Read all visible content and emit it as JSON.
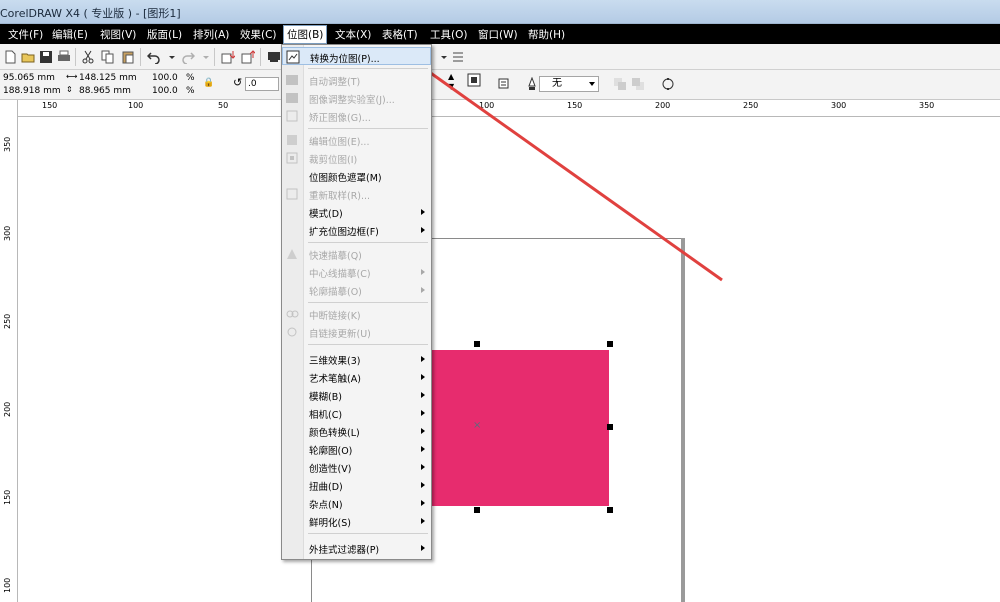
{
  "window": {
    "title": "CorelDRAW X4 ( 专业版 ) - [图形1]"
  },
  "menubar": {
    "items": [
      {
        "label": "文件(F)"
      },
      {
        "label": "编辑(E)"
      },
      {
        "label": "视图(V)"
      },
      {
        "label": "版面(L)"
      },
      {
        "label": "排列(A)"
      },
      {
        "label": "效果(C)"
      },
      {
        "label": "位图(B)"
      },
      {
        "label": "文本(X)"
      },
      {
        "label": "表格(T)"
      },
      {
        "label": "工具(O)"
      },
      {
        "label": "窗口(W)"
      },
      {
        "label": "帮助(H)"
      }
    ],
    "active": "位图(B)"
  },
  "propbar": {
    "x": "95.065 mm",
    "y": "188.918 mm",
    "width": "148.125 mm",
    "height": "88.965 mm",
    "scale_w": "100.0",
    "scale_h": "100.0",
    "percent": "%",
    "rotation": ".0",
    "outline": "无"
  },
  "rulers": {
    "h_ticks": [
      "150",
      "100",
      "50",
      "100",
      "150",
      "200",
      "250",
      "300",
      "350"
    ],
    "v_ticks": [
      "350",
      "300",
      "250",
      "200",
      "150",
      "100"
    ]
  },
  "bitmap_menu": {
    "items": [
      {
        "label": "转换为位图(P)...",
        "enabled": true,
        "icon": "convert-bitmap-icon",
        "highlighted": true
      },
      {
        "label": "自动调整(T)",
        "enabled": false,
        "icon": "auto-adjust-icon"
      },
      {
        "label": "图像调整实验室(J)...",
        "enabled": false,
        "icon": "image-lab-icon"
      },
      {
        "label": "矫正图像(G)...",
        "enabled": false,
        "icon": "straighten-icon"
      },
      {
        "label": "编辑位图(E)...",
        "enabled": false,
        "icon": "edit-bitmap-icon"
      },
      {
        "label": "裁剪位图(I)",
        "enabled": false,
        "icon": "crop-bitmap-icon"
      },
      {
        "label": "位图颜色遮罩(M)",
        "enabled": true
      },
      {
        "label": "重新取样(R)...",
        "enabled": false,
        "icon": "resample-icon"
      },
      {
        "label": "模式(D)",
        "enabled": true,
        "submenu": true
      },
      {
        "label": "扩充位图边框(F)",
        "enabled": true,
        "submenu": true
      },
      {
        "label": "快速描摹(Q)",
        "enabled": false,
        "icon": "quick-trace-icon"
      },
      {
        "label": "中心线描摹(C)",
        "enabled": false,
        "submenu": true
      },
      {
        "label": "轮廓描摹(O)",
        "enabled": false,
        "submenu": true
      },
      {
        "label": "中断链接(K)",
        "enabled": false,
        "icon": "break-link-icon"
      },
      {
        "label": "自链接更新(U)",
        "enabled": false,
        "icon": "update-link-icon"
      },
      {
        "label": "三维效果(3)",
        "enabled": true,
        "submenu": true
      },
      {
        "label": "艺术笔触(A)",
        "enabled": true,
        "submenu": true
      },
      {
        "label": "模糊(B)",
        "enabled": true,
        "submenu": true
      },
      {
        "label": "相机(C)",
        "enabled": true,
        "submenu": true
      },
      {
        "label": "颜色转换(L)",
        "enabled": true,
        "submenu": true
      },
      {
        "label": "轮廓图(O)",
        "enabled": true,
        "submenu": true
      },
      {
        "label": "创造性(V)",
        "enabled": true,
        "submenu": true
      },
      {
        "label": "扭曲(D)",
        "enabled": true,
        "submenu": true
      },
      {
        "label": "杂点(N)",
        "enabled": true,
        "submenu": true
      },
      {
        "label": "鲜明化(S)",
        "enabled": true,
        "submenu": true
      },
      {
        "label": "外挂式过滤器(P)",
        "enabled": true,
        "submenu": true
      }
    ]
  },
  "colors": {
    "rectangle_fill": "#e72c6e",
    "annotation_arrow": "#e0413f",
    "menubar_bg": "#000000"
  }
}
